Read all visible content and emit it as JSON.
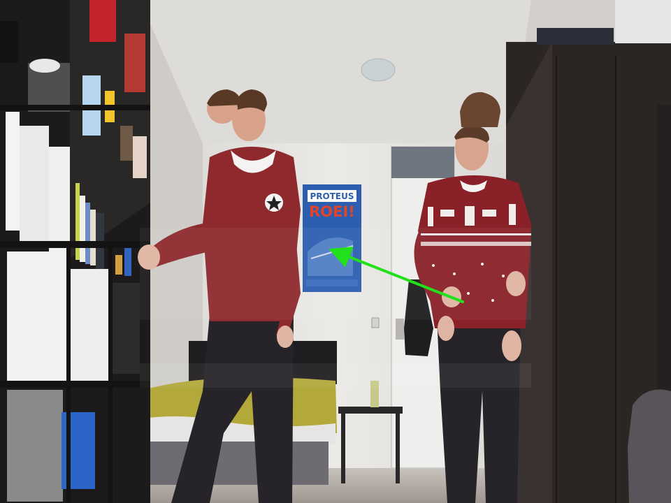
{
  "poster": {
    "line1": "PROTEUS",
    "line2": "ROEI!",
    "accent": "#e0452b",
    "background": "#2d5fb0"
  },
  "colors": {
    "wall": "#e8e6e3",
    "ceiling": "#dcdad7",
    "shelf": "#1c1a1a",
    "wardrobe": "#2b2523",
    "hoodie": "#8e2a2e",
    "sweater": "#8a2028",
    "jeans": "#262428",
    "duvet": "#b3a83a",
    "arrow": "#22e01a"
  },
  "annotation": {
    "type": "motion-arrow",
    "direction": "right-to-left"
  }
}
